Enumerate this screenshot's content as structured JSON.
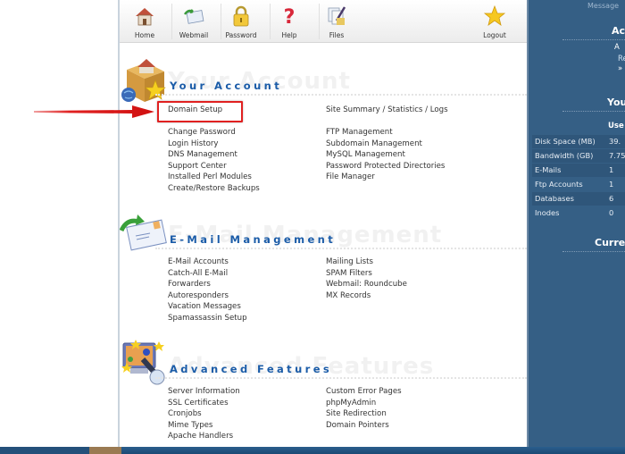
{
  "toolbar": {
    "items": [
      {
        "label": "Home",
        "icon": "home-icon"
      },
      {
        "label": "Webmail",
        "icon": "webmail-icon"
      },
      {
        "label": "Password",
        "icon": "padlock-icon"
      },
      {
        "label": "Help",
        "icon": "question-mark-icon"
      },
      {
        "label": "Files",
        "icon": "files-icon"
      },
      {
        "label": "Logout",
        "icon": "star-icon"
      }
    ]
  },
  "sections": {
    "account": {
      "title": "Your Account",
      "ghost": "Your Account",
      "highlighted": "Domain Setup",
      "col_a": [
        "Change Password",
        "Login History",
        "DNS Management",
        "Support Center",
        "Installed Perl Modules",
        "Create/Restore Backups"
      ],
      "col_b_top": "Site Summary / Statistics / Logs",
      "col_b": [
        "FTP Management",
        "Subdomain Management",
        "MySQL Management",
        "Password Protected Directories",
        "File Manager"
      ]
    },
    "email": {
      "title": "E-Mail Management",
      "ghost": "E-Mail Management",
      "col_a": [
        "E-Mail Accounts",
        "Catch-All E-Mail",
        "Forwarders",
        "Autoresponders",
        "Vacation Messages",
        "Spamassassin Setup"
      ],
      "col_b": [
        "Mailing Lists",
        "SPAM Filters",
        "Webmail: Roundcube",
        "MX Records"
      ]
    },
    "advanced": {
      "title": "Advanced Features",
      "ghost": "Advanced Features",
      "col_a": [
        "Server Information",
        "SSL Certificates",
        "Cronjobs",
        "Mime Types",
        "Apache Handlers"
      ],
      "col_b": [
        "Custom Error Pages",
        "phpMyAdmin",
        "Site Redirection",
        "Domain Pointers"
      ]
    }
  },
  "sidebar": {
    "message": "Message",
    "account_heading": "Ac",
    "account_line1": "A",
    "account_line2": "Re",
    "account_line3": "»",
    "usage_heading": "You",
    "used_label": "Use",
    "stats": [
      {
        "label": "Disk Space (MB)",
        "value": "39."
      },
      {
        "label": "Bandwidth (GB)",
        "value": "7.75"
      },
      {
        "label": "E-Mails",
        "value": "1"
      },
      {
        "label": "Ftp Accounts",
        "value": "1"
      },
      {
        "label": "Databases",
        "value": "6"
      },
      {
        "label": "Inodes",
        "value": "0"
      }
    ],
    "current_heading": "Curren"
  },
  "colors": {
    "section_title": "#1b5ca8",
    "sidebar_bg": "#355f85",
    "highlight": "#e02020"
  }
}
